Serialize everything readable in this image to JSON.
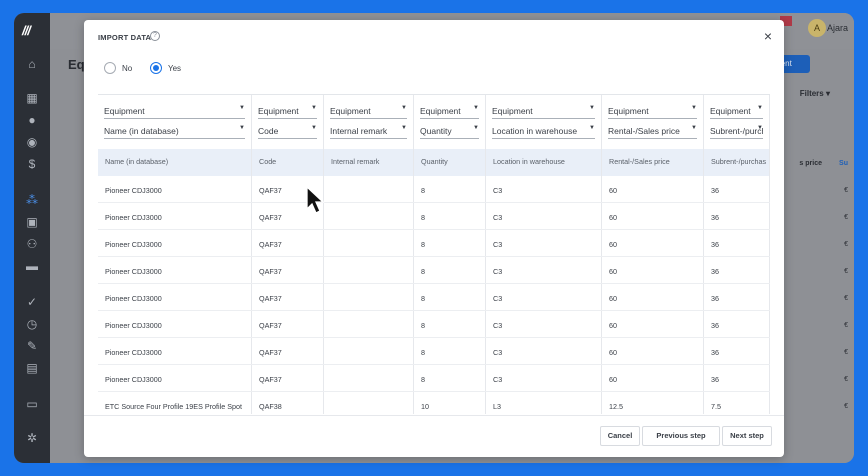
{
  "background": {
    "page_title": "Equipment",
    "user_name": "Ajara",
    "user_initial": "A",
    "action_button": "ment",
    "filters_label": "Filters",
    "column_price": "s price",
    "column_so": "Su",
    "euro_marks": [
      "€",
      "€",
      "€",
      "€",
      "€",
      "€",
      "€",
      "€",
      "€"
    ]
  },
  "modal": {
    "title": "IMPORT DATA",
    "help_icon": "?",
    "close_icon": "×",
    "radio_no": "No",
    "radio_yes": "Yes",
    "selected": "Yes",
    "columns": [
      {
        "entity": "Equipment",
        "field": "Name (in database)",
        "header": "Name (in database)"
      },
      {
        "entity": "Equipment",
        "field": "Code",
        "header": "Code"
      },
      {
        "entity": "Equipment",
        "field": "Internal remark",
        "header": "Internal remark"
      },
      {
        "entity": "Equipment",
        "field": "Quantity",
        "header": "Quantity"
      },
      {
        "entity": "Equipment",
        "field": "Location in warehouse",
        "header": "Location in warehouse"
      },
      {
        "entity": "Equipment",
        "field": "Rental-/Sales price",
        "header": "Rental-/Sales price"
      },
      {
        "entity": "Equipment",
        "field": "Subrent-/purch",
        "header": "Subrent-/purchas"
      }
    ],
    "rows": [
      [
        "Pioneer CDJ3000",
        "QAF37",
        "",
        "8",
        "C3",
        "60",
        "36"
      ],
      [
        "Pioneer CDJ3000",
        "QAF37",
        "",
        "8",
        "C3",
        "60",
        "36"
      ],
      [
        "Pioneer CDJ3000",
        "QAF37",
        "",
        "8",
        "C3",
        "60",
        "36"
      ],
      [
        "Pioneer CDJ3000",
        "QAF37",
        "",
        "8",
        "C3",
        "60",
        "36"
      ],
      [
        "Pioneer CDJ3000",
        "QAF37",
        "",
        "8",
        "C3",
        "60",
        "36"
      ],
      [
        "Pioneer CDJ3000",
        "QAF37",
        "",
        "8",
        "C3",
        "60",
        "36"
      ],
      [
        "Pioneer CDJ3000",
        "QAF37",
        "",
        "8",
        "C3",
        "60",
        "36"
      ],
      [
        "Pioneer CDJ3000",
        "QAF37",
        "",
        "8",
        "C3",
        "60",
        "36"
      ],
      [
        "ETC Source Four Profile 19ES Profile Spot",
        "QAF38",
        "",
        "10",
        "L3",
        "12.5",
        "7.5"
      ]
    ],
    "buttons": {
      "cancel": "Cancel",
      "previous": "Previous step",
      "next": "Next step"
    }
  },
  "colors": {
    "accent": "#1a73e8",
    "sidebar": "#2b2f36",
    "header_row": "#e9eff8"
  }
}
